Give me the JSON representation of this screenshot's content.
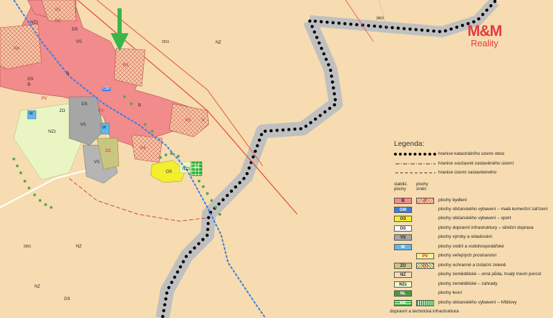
{
  "logo": {
    "brand": "M&M",
    "sub": "Reality"
  },
  "legend": {
    "title": "Legenda:",
    "boundaries": [
      {
        "label": "hranice katastrálního území obce"
      },
      {
        "label": "hranice současně zastavěného území"
      },
      {
        "label": "hranice území zastavitelného"
      }
    ],
    "col_stable": "stabiliz. plochy",
    "col_change": "plochy změn",
    "items": [
      {
        "code": "B",
        "change_code": "R",
        "color": "#f28b8b",
        "label": "plochy bydlení"
      },
      {
        "code": "OM",
        "color": "#3a7de0",
        "label": "plochy občanského vybavení – malá komerční zařízení"
      },
      {
        "code": "OS",
        "color": "#f3ee2e",
        "label": "plochy občanského vybavení – sport"
      },
      {
        "code": "DS",
        "color": "#ffffff",
        "label": "plochy dopravní infrastruktury – silniční doprava"
      },
      {
        "code": "VS",
        "color": "#a6a6a6",
        "label": "plochy výroby a skladování"
      },
      {
        "code": "W",
        "color": "#5fb8ea",
        "label": "plochy vodní a vodohospodářské"
      },
      {
        "change_code": "PV",
        "color": "#f7ee8f",
        "label": "plochy veřejných prostranství"
      },
      {
        "code": "ZO",
        "change_code": "ZO",
        "color": "#c9c77f",
        "label": "plochy ochranné a izolační zeleně"
      },
      {
        "code": "NZ",
        "color": "#f6dcb0",
        "label": "plochy zemědělské – orná půda, trvalý travní porost"
      },
      {
        "code": "NZz",
        "color": "#f0f8cc",
        "label": "plochy zemědělské – zahrady"
      },
      {
        "code": "NL",
        "color": "#4b9a3a",
        "label": "plochy lesní"
      },
      {
        "code": "HR",
        "change_code": "",
        "color": "#2fb52f",
        "label": "plochy občanského vybavení – hřbitovy"
      }
    ],
    "footer": "dopravní a technická infrastruktura"
  },
  "map_labels": {
    "nz_top": "NZ",
    "nz_bottom": "NZ",
    "nz_bottom_left": "NZ",
    "ds_bottom": "DS",
    "r_top1": "R1",
    "r_top2": "R2",
    "r_top3": "R3",
    "r4": "R4",
    "r5": "R5",
    "r6": "R6",
    "r_right": "R",
    "b1": "B",
    "b2": "B",
    "b3": "B",
    "nzz_top": "NZz",
    "nzz_mid": "NZz",
    "nzz_cem": "NZz",
    "hr": "HR",
    "os": "OS",
    "om": "OM",
    "vs1": "VS",
    "vs2": "VS",
    "vs_top": "VS",
    "zo1": "ZO",
    "zo2": "ZO",
    "pv1": "PV",
    "pv2": "PV",
    "w1": "W",
    "w2": "W",
    "ds1": "DS",
    "ds2": "DS",
    "ds3": "DS",
    "parcel1": "2011",
    "parcel2": "2803",
    "parcel3": "2001"
  },
  "colors": {
    "nz": "#f6dcb0",
    "b": "#f28b8b",
    "vs": "#a6a6a6",
    "nzz": "#eaf5c4",
    "road": "#e5503a",
    "boundary": "#000000",
    "buffer": "#bdbdbd",
    "water": "#3a7de0",
    "pointer": "#3ab54a"
  }
}
